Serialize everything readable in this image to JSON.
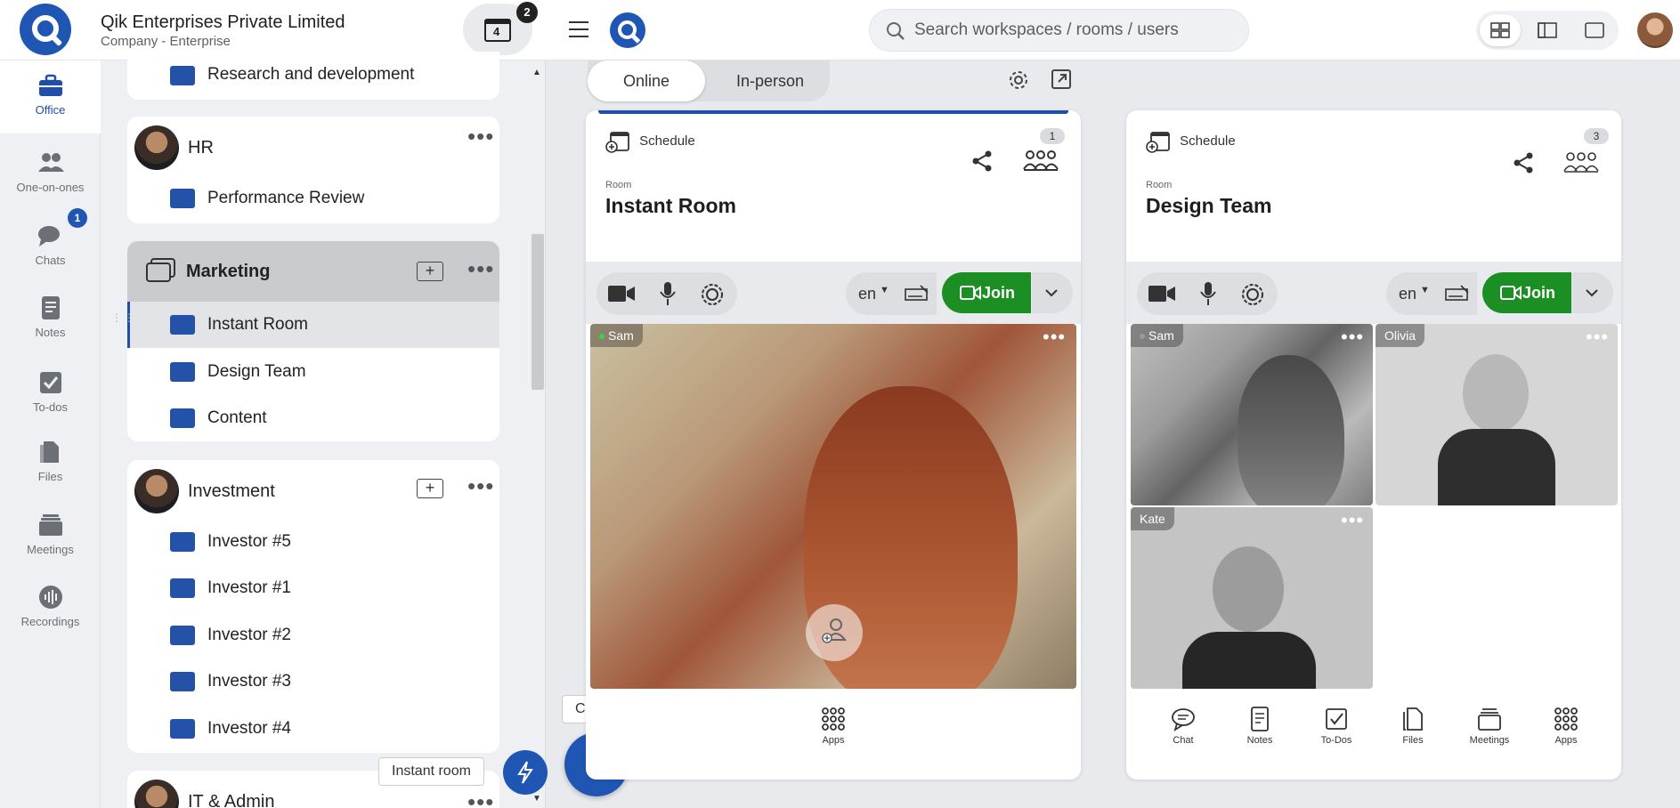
{
  "nav": {
    "items": [
      {
        "label": "Office",
        "icon": "briefcase-icon",
        "active": true
      },
      {
        "label": "One-on-ones",
        "icon": "people-icon"
      },
      {
        "label": "Chats",
        "icon": "chat-bubbles-icon",
        "badge": "1"
      },
      {
        "label": "Notes",
        "icon": "notes-icon"
      },
      {
        "label": "To-dos",
        "icon": "todo-check-icon"
      },
      {
        "label": "Files",
        "icon": "files-icon"
      },
      {
        "label": "Meetings",
        "icon": "meetings-stack-icon"
      },
      {
        "label": "Recordings",
        "icon": "recordings-wave-icon"
      }
    ]
  },
  "company": {
    "name": "Qik Enterprises Private Limited",
    "type": "Company - Enterprise",
    "calendar_day": "4",
    "calendar_badge": "2"
  },
  "workspaces": {
    "partial_top_room": "Research and development",
    "hr": {
      "title": "HR",
      "rooms": [
        "Performance Review"
      ]
    },
    "marketing": {
      "title": "Marketing",
      "rooms": [
        "Instant Room",
        "Design Team",
        "Content"
      ],
      "active_room": "Instant Room"
    },
    "investment": {
      "title": "Investment",
      "rooms": [
        "Investor #5",
        "Investor #1",
        "Investor #2",
        "Investor #3",
        "Investor #4"
      ]
    },
    "it_admin": {
      "title": "IT & Admin"
    }
  },
  "fab": {
    "create_label": "Create",
    "instant_label": "Instant room",
    "create_symbol": "+"
  },
  "topbar": {
    "search_placeholder": "Search workspaces / rooms / users"
  },
  "mode_toggle": {
    "online": "Online",
    "in_person": "In-person",
    "active": "Online"
  },
  "tiles": [
    {
      "schedule_label": "Schedule",
      "count": "1",
      "room_small": "Room",
      "room_name": "Instant Room",
      "lang": "en",
      "join_label": "Join",
      "participants": [
        {
          "name": "Sam",
          "online": true
        }
      ],
      "bottom": [
        {
          "label": "Apps",
          "icon": "apps-grid-icon"
        }
      ]
    },
    {
      "schedule_label": "Schedule",
      "count": "3",
      "room_small": "Room",
      "room_name": "Design Team",
      "lang": "en",
      "join_label": "Join",
      "participants": [
        {
          "name": "Sam",
          "online": true
        },
        {
          "name": "Olivia"
        },
        {
          "name": "Kate"
        }
      ],
      "bottom": [
        {
          "label": "Chat",
          "icon": "chat-icon"
        },
        {
          "label": "Notes",
          "icon": "notes-icon"
        },
        {
          "label": "To-Dos",
          "icon": "todo-icon"
        },
        {
          "label": "Files",
          "icon": "files-icon"
        },
        {
          "label": "Meetings",
          "icon": "meetings-icon"
        },
        {
          "label": "Apps",
          "icon": "apps-grid-icon"
        }
      ]
    }
  ],
  "colors": {
    "brand": "#1f56b4",
    "join_green": "#1b8f23",
    "room_square": "#2452a8"
  }
}
